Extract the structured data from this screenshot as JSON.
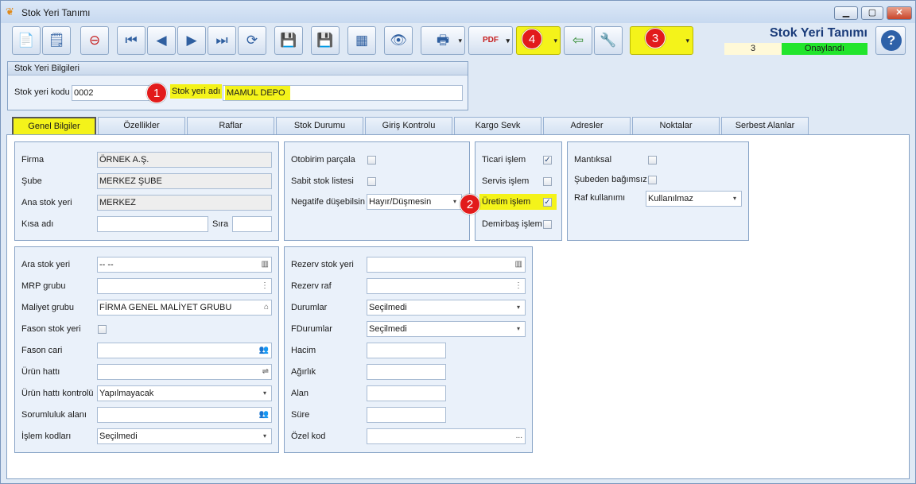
{
  "window": {
    "title": "Stok Yeri Tanımı",
    "minimize": "▁",
    "maximize": "▢",
    "close": "✕"
  },
  "toolbar": {
    "buttons": [
      {
        "name": "new-document-button",
        "icon": "📄"
      },
      {
        "name": "new-from-template-button",
        "icon": "🗒"
      },
      {
        "name": "delete-document-button",
        "icon": "⊖"
      },
      {
        "name": "first-record-button",
        "icon": "⏮"
      },
      {
        "name": "previous-record-button",
        "icon": "◀"
      },
      {
        "name": "next-record-button",
        "icon": "▶"
      },
      {
        "name": "last-record-button",
        "icon": "⏭"
      },
      {
        "name": "refresh-button",
        "icon": "⟳"
      },
      {
        "name": "save-button",
        "icon": "💾"
      },
      {
        "name": "cancel-save-button",
        "icon": "💾"
      },
      {
        "name": "grid-search-button",
        "icon": "▦"
      },
      {
        "name": "preview-button",
        "icon": "👁"
      },
      {
        "name": "print-button",
        "icon": "🖶"
      },
      {
        "name": "export-pdf-button",
        "icon": "PDF"
      },
      {
        "name": "actions-dropdown-button",
        "icon": "▭"
      },
      {
        "name": "import-button",
        "icon": "⇦"
      },
      {
        "name": "tools-button",
        "icon": "🔧"
      },
      {
        "name": "folder-dropdown-button",
        "icon": "📁"
      }
    ],
    "dropdown_arrow": "▾"
  },
  "header": {
    "title": "Stok Yeri Tanımı",
    "record_number": "3",
    "status": "Onaylandı",
    "help_label": "?"
  },
  "badges": {
    "b1": "1",
    "b2": "2",
    "b3": "3",
    "b4": "4"
  },
  "stock_info": {
    "panel_title": "Stok Yeri Bilgileri",
    "code_label": "Stok yeri kodu",
    "code_value": "0002",
    "name_label": "Stok yeri adı",
    "name_value": "MAMUL DEPO"
  },
  "tabs": [
    "Genel Bilgiler",
    "Özellikler",
    "Raflar",
    "Stok Durumu",
    "Giriş Kontrolu",
    "Kargo Sevk",
    "Adresler",
    "Noktalar",
    "Serbest Alanlar"
  ],
  "general": {
    "firma_label": "Firma",
    "firma_value": "ÖRNEK A.Ş.",
    "sube_label": "Şube",
    "sube_value": "MERKEZ ŞUBE",
    "ana_label": "Ana stok yeri",
    "ana_value": "MERKEZ",
    "kisa_label": "Kısa adı",
    "kisa_value": "",
    "sira_label": "Sıra",
    "sira_value": ""
  },
  "options": {
    "otobirim_label": "Otobirim parçala",
    "otobirim_checked": false,
    "sabit_label": "Sabit stok listesi",
    "sabit_checked": false,
    "negatif_label": "Negatife düşebilsin",
    "negatif_value": "Hayır/Düşmesin"
  },
  "flags": {
    "ticari_label": "Ticari işlem",
    "ticari_checked": true,
    "servis_label": "Servis işlem",
    "servis_checked": false,
    "uretim_label": "Üretim işlem",
    "uretim_checked": true,
    "demirbas_label": "Demirbaş işlem",
    "demirbas_checked": false
  },
  "logic": {
    "mantiksal_label": "Mantıksal",
    "mantiksal_checked": false,
    "subeden_label": "Şubeden bağımsız",
    "subeden_checked": false,
    "raf_label": "Raf kullanımı",
    "raf_value": "Kullanılmaz"
  },
  "details_left": {
    "ara_label": "Ara stok yeri",
    "ara_value": "-- --",
    "mrp_label": "MRP grubu",
    "mrp_value": "",
    "maliyet_label": "Maliyet grubu",
    "maliyet_value": "FİRMA GENEL MALİYET GRUBU",
    "fason_label": "Fason stok yeri",
    "fason_checked": false,
    "fasoncari_label": "Fason cari",
    "fasoncari_value": "",
    "urunhatti_label": "Ürün hattı",
    "urunhatti_value": "",
    "urunkontrol_label": "Ürün hattı kontrolü",
    "urunkontrol_value": "Yapılmayacak",
    "sorumluluk_label": "Sorumluluk alanı",
    "sorumluluk_value": "",
    "islem_label": "İşlem kodları",
    "islem_value": "Seçilmedi"
  },
  "details_right": {
    "rezerv_label": "Rezerv stok yeri",
    "rezerv_value": "",
    "rezervraf_label": "Rezerv raf",
    "rezervraf_value": "",
    "durumlar_label": "Durumlar",
    "durumlar_value": "Seçilmedi",
    "fdurumlar_label": "FDurumlar",
    "fdurumlar_value": "Seçilmedi",
    "hacim_label": "Hacim",
    "hacim_value": "",
    "agirlik_label": "Ağırlık",
    "agirlik_value": "",
    "alan_label": "Alan",
    "alan_value": "",
    "sure_label": "Süre",
    "sure_value": "",
    "ozel_label": "Özel kod",
    "ozel_value": ""
  },
  "icons": {
    "barcode": "▥",
    "tree": "⋮",
    "bank": "⌂",
    "people": "👥",
    "line": "⇌",
    "ellipsis": "...",
    "chevron": "▾",
    "check": "✓"
  },
  "colors": {
    "highlight": "#f4f31a",
    "status_green": "#22e52c",
    "badge_red": "#e21b1b",
    "title_blue": "#1b3c7a"
  }
}
